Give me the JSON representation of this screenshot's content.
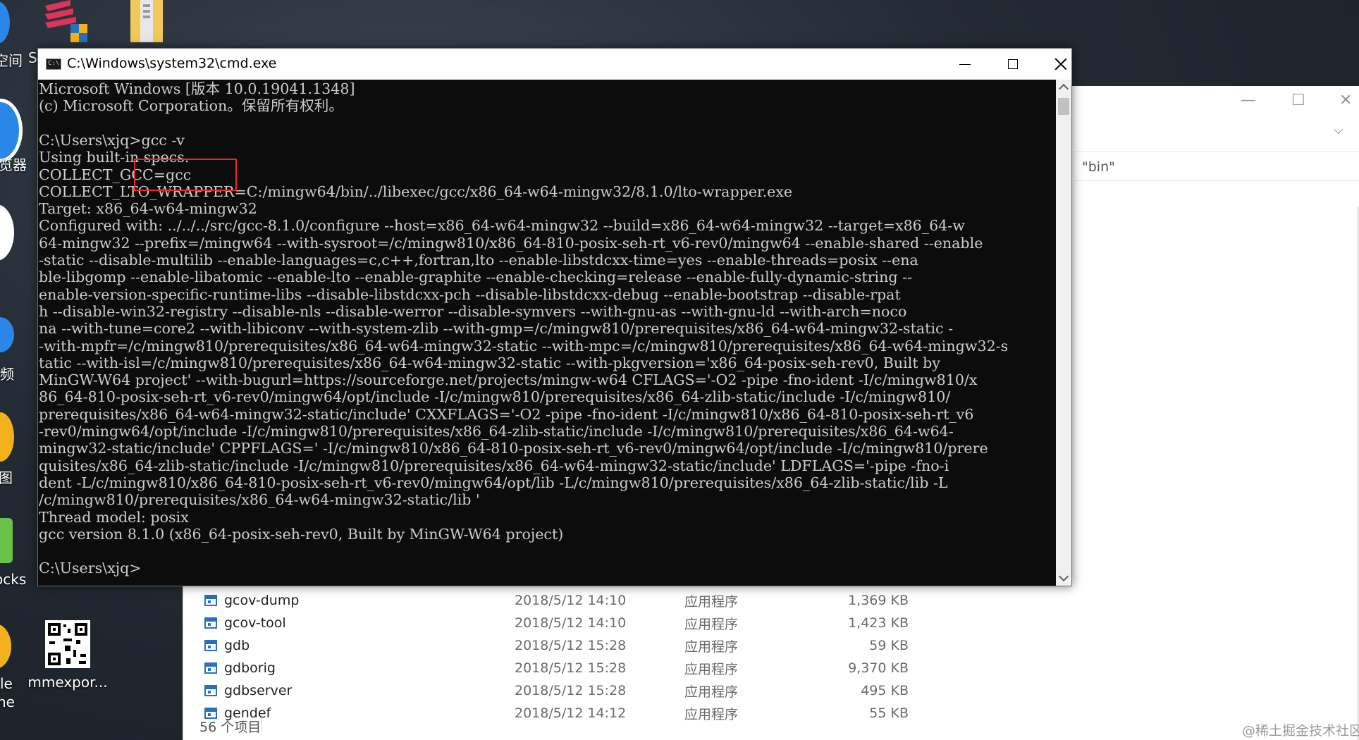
{
  "desktop": {
    "left_labels": [
      "空间",
      "浏览器",
      "视频",
      "图",
      "ocks",
      "le",
      "ne"
    ],
    "mm_label": "mmexpor...",
    "s_fragment": "S"
  },
  "explorer": {
    "path": "\"bin\"",
    "status": "56 个项目",
    "files": [
      {
        "name": "gcov-dump",
        "date": "2018/5/12 14:10",
        "type": "应用程序",
        "size": "1,369 KB"
      },
      {
        "name": "gcov-tool",
        "date": "2018/5/12 14:10",
        "type": "应用程序",
        "size": "1,423 KB"
      },
      {
        "name": "gdb",
        "date": "2018/5/12 15:28",
        "type": "应用程序",
        "size": "59 KB"
      },
      {
        "name": "gdborig",
        "date": "2018/5/12 15:28",
        "type": "应用程序",
        "size": "9,370 KB"
      },
      {
        "name": "gdbserver",
        "date": "2018/5/12 15:28",
        "type": "应用程序",
        "size": "495 KB"
      },
      {
        "name": "gendef",
        "date": "2018/5/12 14:12",
        "type": "应用程序",
        "size": "55 KB"
      }
    ]
  },
  "cmd": {
    "title": "C:\\Windows\\system32\\cmd.exe",
    "lines": [
      "Microsoft Windows [版本 10.0.19041.1348]",
      "(c) Microsoft Corporation。保留所有权利。",
      "",
      "C:\\Users\\xjq>gcc -v",
      "Using built-in specs.",
      "COLLECT_GCC=gcc",
      "COLLECT_LTO_WRAPPER=C:/mingw64/bin/../libexec/gcc/x86_64-w64-mingw32/8.1.0/lto-wrapper.exe",
      "Target: x86_64-w64-mingw32",
      "Configured with: ../../../src/gcc-8.1.0/configure --host=x86_64-w64-mingw32 --build=x86_64-w64-mingw32 --target=x86_64-w",
      "64-mingw32 --prefix=/mingw64 --with-sysroot=/c/mingw810/x86_64-810-posix-seh-rt_v6-rev0/mingw64 --enable-shared --enable",
      "-static --disable-multilib --enable-languages=c,c++,fortran,lto --enable-libstdcxx-time=yes --enable-threads=posix --ena",
      "ble-libgomp --enable-libatomic --enable-lto --enable-graphite --enable-checking=release --enable-fully-dynamic-string --",
      "enable-version-specific-runtime-libs --disable-libstdcxx-pch --disable-libstdcxx-debug --enable-bootstrap --disable-rpat",
      "h --disable-win32-registry --disable-nls --disable-werror --disable-symvers --with-gnu-as --with-gnu-ld --with-arch=noco",
      "na --with-tune=core2 --with-libiconv --with-system-zlib --with-gmp=/c/mingw810/prerequisites/x86_64-w64-mingw32-static -",
      "-with-mpfr=/c/mingw810/prerequisites/x86_64-w64-mingw32-static --with-mpc=/c/mingw810/prerequisites/x86_64-w64-mingw32-s",
      "tatic --with-isl=/c/mingw810/prerequisites/x86_64-w64-mingw32-static --with-pkgversion='x86_64-posix-seh-rev0, Built by",
      "MinGW-W64 project' --with-bugurl=https://sourceforge.net/projects/mingw-w64 CFLAGS='-O2 -pipe -fno-ident -I/c/mingw810/x",
      "86_64-810-posix-seh-rt_v6-rev0/mingw64/opt/include -I/c/mingw810/prerequisites/x86_64-zlib-static/include -I/c/mingw810/",
      "prerequisites/x86_64-w64-mingw32-static/include' CXXFLAGS='-O2 -pipe -fno-ident -I/c/mingw810/x86_64-810-posix-seh-rt_v6",
      "-rev0/mingw64/opt/include -I/c/mingw810/prerequisites/x86_64-zlib-static/include -I/c/mingw810/prerequisites/x86_64-w64-",
      "mingw32-static/include' CPPFLAGS=' -I/c/mingw810/x86_64-810-posix-seh-rt_v6-rev0/mingw64/opt/include -I/c/mingw810/prere",
      "quisites/x86_64-zlib-static/include -I/c/mingw810/prerequisites/x86_64-w64-mingw32-static/include' LDFLAGS='-pipe -fno-i",
      "dent -L/c/mingw810/x86_64-810-posix-seh-rt_v6-rev0/mingw64/opt/lib -L/c/mingw810/prerequisites/x86_64-zlib-static/lib -L",
      "/c/mingw810/prerequisites/x86_64-w64-mingw32-static/lib '",
      "Thread model: posix",
      "gcc version 8.1.0 (x86_64-posix-seh-rev0, Built by MinGW-W64 project)",
      "",
      "C:\\Users\\xjq>"
    ]
  },
  "watermark": "@稀土掘金技术社区",
  "colors": {
    "highlight": "#e52b2b",
    "console_bg": "#0c0c0c",
    "console_fg": "#cccccc",
    "file_icon": "#2a6fc0"
  }
}
